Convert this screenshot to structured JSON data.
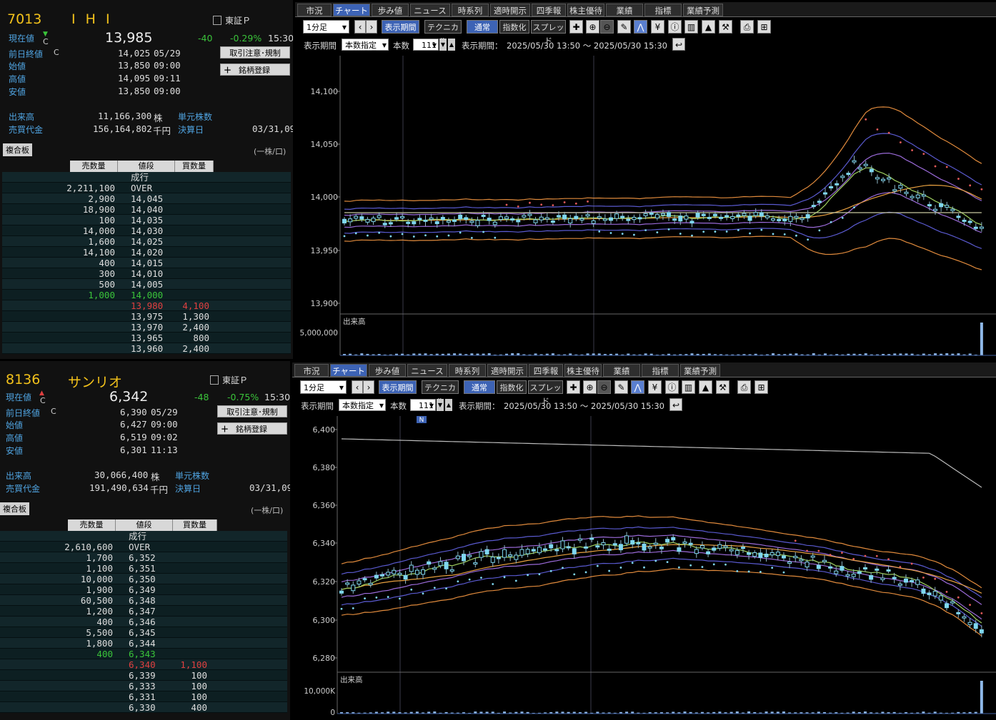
{
  "stock1": {
    "code": "7013",
    "name": "I H I",
    "exchange": "東証Ｐ",
    "cur_label": "現在値",
    "cur_mark": "C",
    "price": "13,985",
    "change": "-40",
    "change_pct": "-0.29%",
    "time": "15:30",
    "prev_label": "前日終値",
    "prev_mark": "C",
    "prev_val": "14,025",
    "prev_date": "05/29",
    "open_label": "始値",
    "open_val": "13,850",
    "open_time": "09:00",
    "high_label": "高値",
    "high_val": "14,095",
    "high_time": "09:11",
    "low_label": "安値",
    "low_val": "13,850",
    "low_time": "09:00",
    "btn_rules": "取引注意･規制",
    "btn_register": "銘柄登録",
    "vol_label": "出来高",
    "vol_val": "11,166,300",
    "vol_unit": "株",
    "amt_label": "売買代金",
    "amt_val": "156,164,802",
    "amt_unit": "千円",
    "unit_label": "単元株数",
    "fiscal_label": "決算日",
    "fiscal_val": "03/31,09",
    "book_tag": "複合板",
    "unit_note": "(一株/口)",
    "book_headers": [
      "売数量",
      "値段",
      "買数量"
    ],
    "book": [
      {
        "sell": "",
        "price": "成行",
        "buy": "",
        "color": "#ddd"
      },
      {
        "sell": "2,211,100",
        "price": "OVER",
        "buy": "",
        "color": "#ddd"
      },
      {
        "sell": "2,900",
        "price": "14,045",
        "buy": "",
        "color": "#ddd"
      },
      {
        "sell": "18,900",
        "price": "14,040",
        "buy": "",
        "color": "#ddd"
      },
      {
        "sell": "100",
        "price": "14,035",
        "buy": "",
        "color": "#ddd"
      },
      {
        "sell": "14,000",
        "price": "14,030",
        "buy": "",
        "color": "#ddd"
      },
      {
        "sell": "1,600",
        "price": "14,025",
        "buy": "",
        "color": "#ddd"
      },
      {
        "sell": "14,100",
        "price": "14,020",
        "buy": "",
        "color": "#ddd"
      },
      {
        "sell": "400",
        "price": "14,015",
        "buy": "",
        "color": "#ddd"
      },
      {
        "sell": "300",
        "price": "14,010",
        "buy": "",
        "color": "#ddd"
      },
      {
        "sell": "500",
        "price": "14,005",
        "buy": "",
        "color": "#ddd"
      },
      {
        "sell": "1,000",
        "price": "14,000",
        "buy": "",
        "color": "#3ac43a"
      },
      {
        "sell": "",
        "price": "13,980",
        "buy": "4,100",
        "color": "#e04040"
      },
      {
        "sell": "",
        "price": "13,975",
        "buy": "1,300",
        "color": "#ddd"
      },
      {
        "sell": "",
        "price": "13,970",
        "buy": "2,400",
        "color": "#ddd"
      },
      {
        "sell": "",
        "price": "13,965",
        "buy": "800",
        "color": "#ddd"
      },
      {
        "sell": "",
        "price": "13,960",
        "buy": "2,400",
        "color": "#ddd"
      }
    ]
  },
  "stock2": {
    "code": "8136",
    "name": "サンリオ",
    "exchange": "東証Ｐ",
    "cur_label": "現在値",
    "cur_mark": "C",
    "price": "6,342",
    "change": "-48",
    "change_pct": "-0.75%",
    "time": "15:30",
    "prev_label": "前日終値",
    "prev_mark": "C",
    "prev_val": "6,390",
    "prev_date": "05/29",
    "open_label": "始値",
    "open_val": "6,427",
    "open_time": "09:00",
    "high_label": "高値",
    "high_val": "6,519",
    "high_time": "09:02",
    "low_label": "安値",
    "low_val": "6,301",
    "low_time": "11:13",
    "btn_rules": "取引注意･規制",
    "btn_register": "銘柄登録",
    "vol_label": "出来高",
    "vol_val": "30,066,400",
    "vol_unit": "株",
    "amt_label": "売買代金",
    "amt_val": "191,490,634",
    "amt_unit": "千円",
    "unit_label": "単元株数",
    "fiscal_label": "決算日",
    "fiscal_val": "03/31,09",
    "book_tag": "複合板",
    "unit_note": "(一株/口)",
    "book_headers": [
      "売数量",
      "値段",
      "買数量"
    ],
    "book": [
      {
        "sell": "",
        "price": "成行",
        "buy": "",
        "color": "#ddd"
      },
      {
        "sell": "2,610,600",
        "price": "OVER",
        "buy": "",
        "color": "#ddd"
      },
      {
        "sell": "1,700",
        "price": "6,352",
        "buy": "",
        "color": "#ddd"
      },
      {
        "sell": "1,100",
        "price": "6,351",
        "buy": "",
        "color": "#ddd"
      },
      {
        "sell": "10,000",
        "price": "6,350",
        "buy": "",
        "color": "#ddd"
      },
      {
        "sell": "1,900",
        "price": "6,349",
        "buy": "",
        "color": "#ddd"
      },
      {
        "sell": "60,500",
        "price": "6,348",
        "buy": "",
        "color": "#ddd"
      },
      {
        "sell": "1,200",
        "price": "6,347",
        "buy": "",
        "color": "#ddd"
      },
      {
        "sell": "400",
        "price": "6,346",
        "buy": "",
        "color": "#ddd"
      },
      {
        "sell": "5,500",
        "price": "6,345",
        "buy": "",
        "color": "#ddd"
      },
      {
        "sell": "1,800",
        "price": "6,344",
        "buy": "",
        "color": "#ddd"
      },
      {
        "sell": "400",
        "price": "6,343",
        "buy": "",
        "color": "#3ac43a"
      },
      {
        "sell": "",
        "price": "6,340",
        "buy": "1,100",
        "color": "#e04040"
      },
      {
        "sell": "",
        "price": "6,339",
        "buy": "100",
        "color": "#ddd"
      },
      {
        "sell": "",
        "price": "6,333",
        "buy": "100",
        "color": "#ddd"
      },
      {
        "sell": "",
        "price": "6,331",
        "buy": "100",
        "color": "#ddd"
      },
      {
        "sell": "",
        "price": "6,330",
        "buy": "400",
        "color": "#ddd"
      }
    ]
  },
  "tabs": [
    "市況",
    "チャート",
    "歩み値",
    "ニュース",
    "時系列",
    "適時開示",
    "四季報",
    "株主優待",
    "業績",
    "指標",
    "業績予測"
  ],
  "active_tab": "チャート",
  "toolbar": {
    "interval": "1分足",
    "btn_period": "表示期間",
    "btn_technical": "テクニカル",
    "btn_normal": "通常",
    "btn_index": "指数化",
    "btn_spread": "スプレッド"
  },
  "period_bar": {
    "label": "表示期間",
    "mode": "本数指定",
    "count_label": "本数",
    "count": "111",
    "range_label": "表示期間：",
    "range": "2025/05/30 13:50 ～ 2025/05/30 15:30"
  },
  "chart1": {
    "y_ticks": [
      "14,100",
      "14,050",
      "14,000",
      "13,950",
      "13,900"
    ],
    "vol_label": "出来高",
    "vol_tick": "5,000,000",
    "colors": {
      "up": "#7fd7f0",
      "band_outer": "#e08a3c",
      "band_inner": "#9a6ad8",
      "sar": "#e25a5a"
    }
  },
  "chart2": {
    "y_ticks": [
      "6,400",
      "6,380",
      "6,360",
      "6,340",
      "6,320",
      "6,300",
      "6,280"
    ],
    "vol_label": "出来高",
    "vol_tick": "10,000K",
    "vol_zero": "0",
    "news_badge": "N"
  }
}
